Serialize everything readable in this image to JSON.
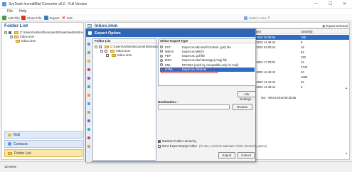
{
  "window": {
    "title": "SysTools IncrediMail Converter v5.0 - Full Version",
    "controls": {
      "minimize": "—",
      "maximize": "☐",
      "close": "✕"
    }
  },
  "menu": [
    "File",
    "Help"
  ],
  "toolbar": {
    "add_file": "Add File",
    "close_file": "Close File",
    "export": "Export",
    "exit": "Exit",
    "switch_view": "Switch View"
  },
  "folder_list": {
    "title": "Folder List",
    "root": "C:\\Users\\Admin\\Documents\\Downloads\\Inbox",
    "child1": "Inbox.imm",
    "child2": "Inbox.imm"
  },
  "nav": {
    "mail": "Mail",
    "contacts": "Contacts",
    "folder_list": "Folder List"
  },
  "main": {
    "title": "Inbox.imm",
    "export_selected": "Export Selected",
    "headers": [
      "ived",
      "Size(KB)"
    ],
    "rows": [
      {
        "date": "-2019 09:28:56",
        "size": "186",
        "selected": true
      },
      {
        "date": "-2020 14:48:42",
        "size": "8"
      },
      {
        "date": "-2020 04:00:42",
        "size": "16"
      },
      {
        "date": "",
        "size": "52"
      },
      {
        "date": "",
        "size": "153"
      },
      {
        "date": "-2004 17:30:02",
        "size": "42"
      },
      {
        "date": "",
        "size": "2742"
      },
      {
        "date": "-2020 14:46:42",
        "size": "10"
      },
      {
        "date": "",
        "size": "1689"
      },
      {
        "date": "-2020 14:44:42",
        "size": "32"
      },
      {
        "date": "-2020 14:48:42",
        "size": "6"
      }
    ],
    "detail_time": "ime : 09-04-2019 09:28:56"
  },
  "status": {
    "items": "12 Items"
  },
  "dialog": {
    "title": "Export Option",
    "close": "✕",
    "folder_list_head": "Folder List",
    "tree_root": "C:\\Users\\Admin\\Documents\\Downl",
    "tree_child1": "Inbox.imm",
    "tree_child2": "Inbox.imm",
    "export_type_head": "Select Export Type",
    "options": [
      {
        "key": "PST",
        "desc": "Export as Microsoft Outlook (.pst) file",
        "selected": false
      },
      {
        "key": "MBOX",
        "desc": "Export as MBOX",
        "selected": false
      },
      {
        "key": "PDF",
        "desc": "Export as .pdf file",
        "selected": false
      },
      {
        "key": "MSG",
        "desc": "Export as Mail Message(.msg) file",
        "selected": false
      },
      {
        "key": "EML",
        "desc": "RFC822 (used by compatible only for mail)",
        "selected": false
      },
      {
        "key": "HTML",
        "desc": "Export as .html file",
        "selected": true
      }
    ],
    "adv_settings": "Adv. Settings...",
    "destination_label": "Destination :",
    "destination_value": "",
    "browse": "Browse",
    "maintain_hierarchy": "Maintain Folder Hierarchy",
    "dont_export_empty": "Don't Export Empty Folder",
    "dont_export_note": "(To use, Uncheck Maintain Folder Hierarchy option)",
    "export_btn": "Export",
    "cancel_btn": "Cancel"
  },
  "colors": {
    "dialog_title_bg": "#2f65b6",
    "selection": "#2e6cc8",
    "highlight_box": "#e02020",
    "header_text": "#1d4f91"
  }
}
